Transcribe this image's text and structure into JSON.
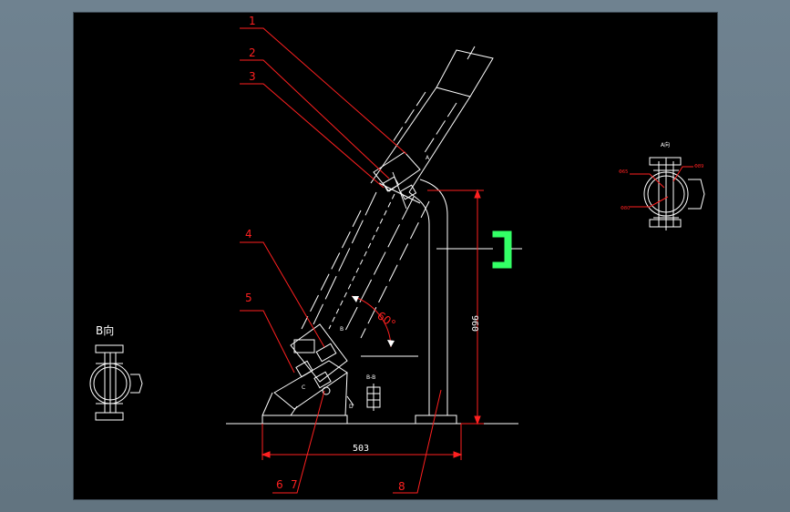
{
  "drawing": {
    "part_labels": [
      "1",
      "2",
      "3",
      "4",
      "5",
      "6",
      "7",
      "8"
    ],
    "view_b_title": "B向",
    "dimension_horizontal": "503",
    "dimension_vertical": "960",
    "angle": "60°",
    "section_mark": "B-B",
    "view_mark": "A",
    "small_marks": {
      "c": "C",
      "b": "B",
      "d": "D"
    },
    "right_view": {
      "title": "A向",
      "leader_labels": [
        "Φ65",
        "Φ80",
        "Φ89"
      ]
    }
  },
  "colors": {
    "background": "#000000",
    "line": "#ffffff",
    "leader": "#ff2020",
    "bracket": "#33ff66",
    "dimension": "#ff2020"
  }
}
